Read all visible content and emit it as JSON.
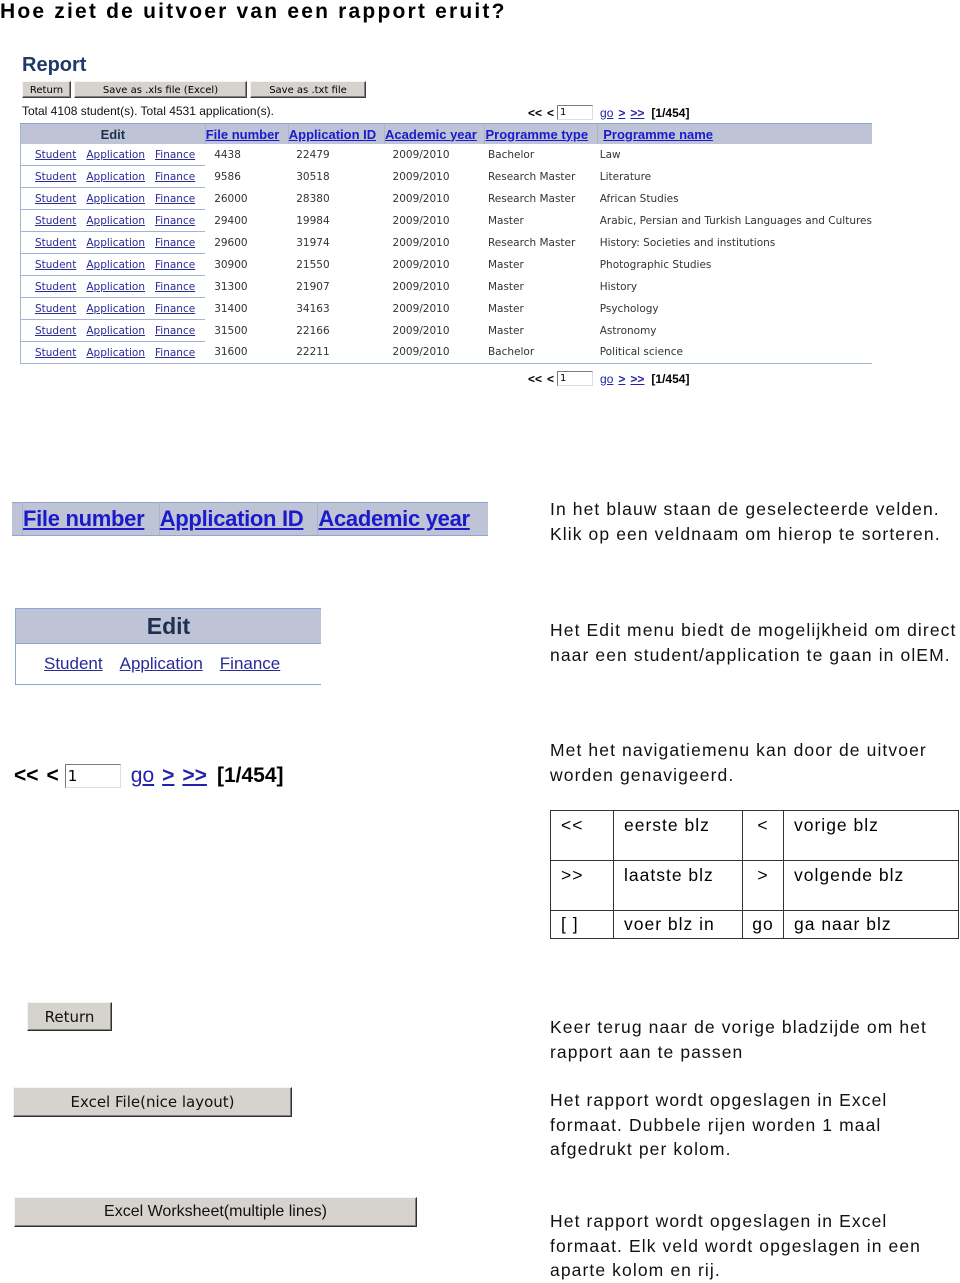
{
  "page_title": "Hoe ziet de uitvoer van een rapport eruit?",
  "report": {
    "heading": "Report",
    "buttons": {
      "return": "Return",
      "save_xls": "Save as .xls file (Excel)",
      "save_txt": "Save as .txt file"
    },
    "totals": "Total 4108 student(s).  Total 4531 application(s).",
    "pager": {
      "first": "<<",
      "prev": "<",
      "page_input": "1",
      "go": "go",
      "next": ">",
      "last": ">>",
      "page_info": "[1/454]"
    },
    "columns": {
      "edit": "Edit",
      "file_number": "File number",
      "application_id": "Application ID",
      "academic_year": "Academic year",
      "programme_type": "Programme type",
      "programme_name": "Programme name"
    },
    "edit_links": [
      "Student",
      "Application",
      "Finance"
    ],
    "rows": [
      {
        "file_number": "4438",
        "application_id": "22479",
        "academic_year": "2009/2010",
        "programme_type": "Bachelor",
        "programme_name": "Law"
      },
      {
        "file_number": "9586",
        "application_id": "30518",
        "academic_year": "2009/2010",
        "programme_type": "Research Master",
        "programme_name": "Literature"
      },
      {
        "file_number": "26000",
        "application_id": "28380",
        "academic_year": "2009/2010",
        "programme_type": "Research Master",
        "programme_name": "African Studies"
      },
      {
        "file_number": "29400",
        "application_id": "19984",
        "academic_year": "2009/2010",
        "programme_type": "Master",
        "programme_name": "Arabic, Persian and Turkish Languages and Cultures"
      },
      {
        "file_number": "29600",
        "application_id": "31974",
        "academic_year": "2009/2010",
        "programme_type": "Research Master",
        "programme_name": "History: Societies and institutions"
      },
      {
        "file_number": "30900",
        "application_id": "21550",
        "academic_year": "2009/2010",
        "programme_type": "Master",
        "programme_name": "Photographic Studies"
      },
      {
        "file_number": "31300",
        "application_id": "21907",
        "academic_year": "2009/2010",
        "programme_type": "Master",
        "programme_name": "History"
      },
      {
        "file_number": "31400",
        "application_id": "34163",
        "academic_year": "2009/2010",
        "programme_type": "Master",
        "programme_name": "Psychology"
      },
      {
        "file_number": "31500",
        "application_id": "22166",
        "academic_year": "2009/2010",
        "programme_type": "Master",
        "programme_name": "Astronomy"
      },
      {
        "file_number": "31600",
        "application_id": "22211",
        "academic_year": "2009/2010",
        "programme_type": "Bachelor",
        "programme_name": "Political science"
      }
    ]
  },
  "zoom_headers": [
    "File number",
    "Application ID",
    "Academic year"
  ],
  "zoom_edit": {
    "title": "Edit",
    "links": [
      "Student",
      "Application",
      "Finance"
    ]
  },
  "explanations": {
    "headers": "In het blauw staan de geselecteerde velden. Klik op een veldnaam om hierop te sorteren.",
    "edit": "Het Edit menu biedt de mogelijkheid om direct naar een student/application te gaan in olEM.",
    "navigation": "Met het navigatiemenu kan door de uitvoer worden genavigeerd.",
    "return": "Keer terug naar de vorige bladzijde om het rapport aan te passen",
    "excel_file": "Het rapport wordt opgeslagen in Excel formaat. Dubbele rijen worden 1 maal afgedrukt per kolom.",
    "excel_worksheet": "Het rapport wordt opgeslagen in Excel formaat. Elk veld wordt opgeslagen in een aparte kolom en rij."
  },
  "nav_legend": [
    {
      "sym1": "<<",
      "desc1": "eerste blz",
      "sym2": "<",
      "desc2": "vorige blz"
    },
    {
      "sym1": ">>",
      "desc1": "laatste blz",
      "sym2": ">",
      "desc2": "volgende blz"
    },
    {
      "sym1": "[  ]",
      "desc1": "voer blz in",
      "sym2": "go",
      "desc2": "ga naar blz"
    }
  ],
  "big_buttons": {
    "return": "Return",
    "excel_file": "Excel File(nice layout)",
    "excel_worksheet": "Excel Worksheet(multiple lines)"
  }
}
